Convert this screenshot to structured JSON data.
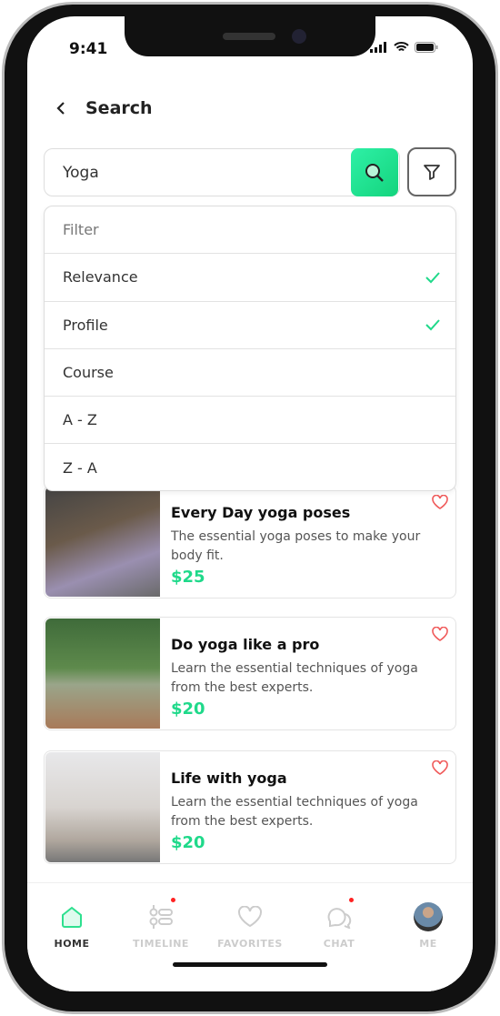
{
  "status": {
    "time": "9:41"
  },
  "header": {
    "title": "Search"
  },
  "search": {
    "value": "Yoga"
  },
  "filter_menu": {
    "header": "Filter",
    "options": [
      {
        "label": "Relevance",
        "checked": true
      },
      {
        "label": "Profile",
        "checked": true
      },
      {
        "label": "Course",
        "checked": false
      },
      {
        "label": "A - Z",
        "checked": false
      },
      {
        "label": "Z - A",
        "checked": false
      }
    ]
  },
  "results": [
    {
      "title": "Every Day yoga poses",
      "desc": "The essential yoga poses to make your body fit.",
      "price": "$25"
    },
    {
      "title": "Do yoga like a pro",
      "desc": "Learn the essential techniques of yoga from the best experts.",
      "price": "$20"
    },
    {
      "title": "Life with yoga",
      "desc": "Learn the essential techniques of yoga from the best experts.",
      "price": "$20"
    }
  ],
  "tabs": [
    {
      "label": "HOME",
      "icon": "home-icon"
    },
    {
      "label": "TIMELINE",
      "icon": "timeline-icon"
    },
    {
      "label": "FAVORITES",
      "icon": "heart-icon"
    },
    {
      "label": "CHAT",
      "icon": "chat-icon"
    },
    {
      "label": "ME",
      "icon": "avatar"
    }
  ],
  "colors": {
    "accent": "#1fd98a",
    "heart": "#f05a5a",
    "badge": "#ff2222"
  }
}
